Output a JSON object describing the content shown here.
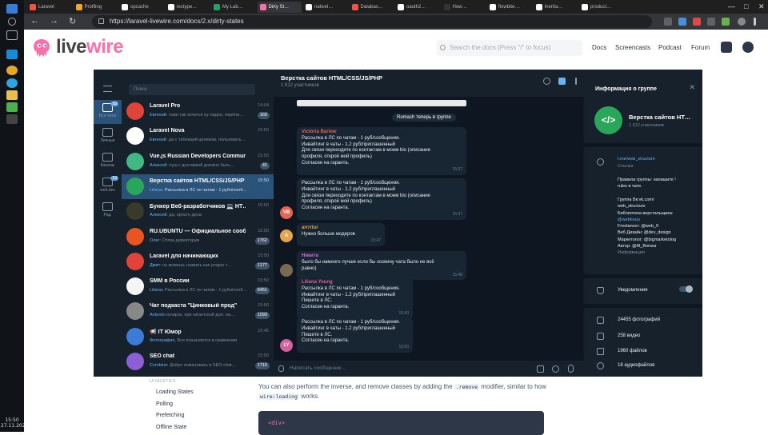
{
  "taskbar": {
    "time": "15:50",
    "date": "27.11.2020"
  },
  "browser": {
    "tabs": [
      {
        "label": "Laravel",
        "color": "#f55247"
      },
      {
        "label": "Profiling",
        "color": "#f5a623"
      },
      {
        "label": "opcache",
        "color": "#ffffff"
      },
      {
        "label": "rectype…",
        "color": "#ffffff"
      },
      {
        "label": "My Lab…",
        "color": "#1fa463"
      },
      {
        "label": "Dirty St…",
        "color": "#fb70a9",
        "active": true
      },
      {
        "label": "nativel…",
        "color": "#ffffff"
      },
      {
        "label": "Databas…",
        "color": "#f55247"
      },
      {
        "label": "oauth2…",
        "color": "#ffffff"
      },
      {
        "label": "How…",
        "color": "#333333"
      },
      {
        "label": "flowbite…",
        "color": "#ffffff"
      },
      {
        "label": "Inertia…",
        "color": "#ffffff"
      },
      {
        "label": "product…",
        "color": "#ffffff"
      }
    ],
    "url": "https://laravel-livewire.com/docs/2.x/dirty-states"
  },
  "site": {
    "logo_part1": "live",
    "logo_part2": "wire",
    "search_placeholder": "Search the docs (Press \"/\" to focus)",
    "nav": [
      "Docs",
      "Screencasts",
      "Podcast",
      "Forum"
    ],
    "sidebar_links": [
      "Loading States",
      "Polling",
      "Prefetching",
      "Offline State"
    ],
    "sidebar_header": "UI NICETIES",
    "para_part1": "You can also perform the inverse, and remove classes by adding the",
    "para_code1": ".remove",
    "para_part2": "modifier, similar to how",
    "para_code2": "wire:loading",
    "para_part3": "works.",
    "code_line": "<div>"
  },
  "telegram": {
    "folders": [
      {
        "label": "Все чаты",
        "badge": "99"
      },
      {
        "label": "Личные",
        "badge": ""
      },
      {
        "label": "Каналы",
        "badge": ""
      },
      {
        "label": "web.dev",
        "badge": "13"
      },
      {
        "label": "Ред.",
        "badge": ""
      }
    ],
    "search_placeholder": "Поиск",
    "chats": [
      {
        "name": "Laravel Pro",
        "time": "14:04",
        "sender": "Евгений:",
        "preview": "тоже так хочется ну ладно, перепи…",
        "count": "160",
        "avatar": "#e0433a"
      },
      {
        "name": "Laravel Nova",
        "time": "15:50",
        "sender": "Евгений:",
        "preview": "да с таблицей целиком, пользовать…",
        "count": "",
        "avatar": "#ffffff"
      },
      {
        "name": "Vue.js Russian Developers Community",
        "time": "15:50",
        "sender": "Алексей:",
        "preview": "пуш с доставкой должно быть…",
        "count": "41",
        "avatar": "#41b883"
      },
      {
        "name": "Верстка сайтов HTML/CSS/JS/PHP",
        "time": "15:50",
        "sender": "Liliana:",
        "preview": "Рассылка в ЛС по чатам - 1 рубл/сооб…",
        "count": "",
        "avatar": "#2aa65a",
        "selected": true
      },
      {
        "name": "Бункер Веб-разработчиков 💻 НТ…",
        "time": "15:50",
        "sender": "Алексей:",
        "preview": "да, просто дела",
        "count": "",
        "avatar": "#3a3a2a"
      },
      {
        "name": "RU.UBUNTU — Официальное сооб…",
        "time": "15:50",
        "sender": "Олег:",
        "preview": "Отлка директории",
        "count": "1762",
        "avatar": "#e95420"
      },
      {
        "name": "Laravel для начинающих",
        "time": "15:50",
        "sender": "Дмит:",
        "preview": "ну можешь назвать как угодно т…",
        "count": "1177",
        "avatar": "#e0433a"
      },
      {
        "name": "SMM в России",
        "time": "15:50",
        "sender": "Liliana:",
        "preview": "Рассылка в ЛС по чатам - 1 рубл/сооб…",
        "count": "6451",
        "avatar": "#f5f5f5"
      },
      {
        "name": "Чат подкаста \"Цинковый прод\"",
        "time": "15:50",
        "sender": "Antonio",
        "preview": "копирок, при гигантской дол. на…",
        "count": "1093",
        "avatar": "#888888"
      },
      {
        "name": "📢 IT Юмор",
        "time": "15:45",
        "sender": "Фотография,",
        "preview": "Все пошаляется в сравнении",
        "count": "",
        "avatar": "#3c7bd6"
      },
      {
        "name": "SEO chat",
        "time": "15:50",
        "sender": "Combine:",
        "preview": "Добро пожаловать в SEO chat…",
        "count": "1710",
        "avatar": "#8b5fd6"
      }
    ],
    "conversation": {
      "title": "Верстка сайтов HTML/CSS/JS/PHP",
      "subtitle": "1 612 участников",
      "system_message": "Romach теперь в группе",
      "messages": [
        {
          "author": "Victoria Barlow",
          "author_color": "#e56555",
          "lines": [
            "Рассылка в ЛС по чатам - 1 руб/сообщения.",
            "Инвайтинг в чаты - 1.2 руб/приглашенный",
            "Для связи переходите по контактам в моем bio (описание",
            "профиля, открой мой профиль)",
            "Согласен на гаранта."
          ],
          "time": "15:37",
          "initials": "",
          "avatar_color": ""
        },
        {
          "author": "",
          "author_color": "",
          "lines": [
            "Рассылка в ЛС по чатам - 1 руб/сообщения.",
            "Инвайтинг в чаты - 1.2 руб/приглашенный",
            "Для связи переходите по контактам в моем bio (описание",
            "профиля, открой мой профиль)",
            "Согласен на гаранта."
          ],
          "time": "15:37",
          "initials": "VB",
          "avatar_color": "#e56555"
        },
        {
          "author": "arrrrtur",
          "author_color": "#e5a64b",
          "lines": [
            "Нужно больше модеров"
          ],
          "time": "15:47",
          "initials": "A",
          "avatar_color": "#e5a64b"
        },
        {
          "author": "Никита",
          "author_color": "#d66ad6",
          "lines": [
            "было бы намного лучше если бы хозяину чата было не всё",
            "равно)"
          ],
          "time": "15:48",
          "initials": "",
          "avatar_color": "#7b6a53"
        },
        {
          "author": "Liliana Young",
          "author_color": "#d65fa0",
          "lines": [
            "Рассылка в ЛС по чатам - 1 руб/сообщения.",
            "Инвайтинг в чаты - 1.2 руб/приглашенный",
            "Пишите в ЛС.",
            "Согласен на гаранта."
          ],
          "time": "15:50",
          "initials": "",
          "avatar_color": ""
        },
        {
          "author": "",
          "author_color": "",
          "lines": [
            "Рассылка в ЛС по чатам - 1 руб/сообщения.",
            "Инвайтинг в чаты - 1.2 руб/приглашенный",
            "Пишите в ЛС.",
            "Согласен на гаранта."
          ],
          "time": "15:50",
          "initials": "LY",
          "avatar_color": "#d65fa0"
        }
      ],
      "input_placeholder": "Написать сообщение..."
    },
    "info": {
      "header": "Информация о группе",
      "group_name": "Верстка сайтов HT…",
      "members": "1 612 участников",
      "link": "t.me/web_structure",
      "link_label": "Ссылка",
      "desc_lines": [
        {
          "t": "Правила группы: напишите !",
          "c": ""
        },
        {
          "t": "rules в чате.",
          "c": ""
        },
        {
          "t": "",
          "c": ""
        },
        {
          "t": "Группа Вк:vk.com/",
          "c": ""
        },
        {
          "t": "web_structure",
          "c": ""
        },
        {
          "t": "Библиотека верстальщика:",
          "c": ""
        },
        {
          "t": "@webbrary",
          "c": "link"
        },
        {
          "t": "Freelancer: @web_fl",
          "c": ""
        },
        {
          "t": "Веб Дизайн: @dev_design",
          "c": ""
        },
        {
          "t": "Маркетолог: @bigmarketolog",
          "c": ""
        },
        {
          "t": "Автор: @M_Bonwa",
          "c": ""
        },
        {
          "t": "Информация",
          "c": "mut"
        }
      ],
      "notifications": "Уведомления",
      "media": [
        "24455 фотографий",
        "258 видео",
        "1960 файлов",
        "18 аудиофайлов"
      ]
    }
  }
}
